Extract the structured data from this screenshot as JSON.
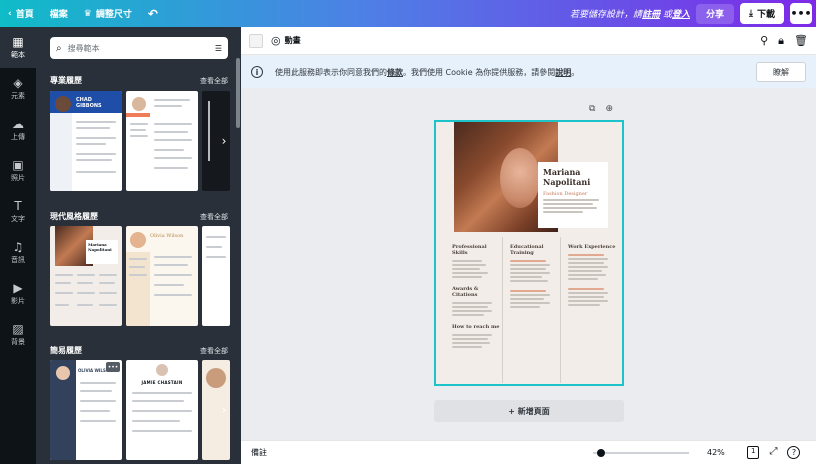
{
  "topbar": {
    "home": "首頁",
    "file": "檔案",
    "resize": "調整尺寸",
    "save_prompt": "若要儲存設計，請",
    "register": "註冊",
    "or": "或",
    "login": "登入",
    "share": "分享",
    "download": "下載"
  },
  "rail": [
    {
      "label": "範本",
      "icon": "template-icon"
    },
    {
      "label": "元素",
      "icon": "elements-icon"
    },
    {
      "label": "上傳",
      "icon": "upload-icon"
    },
    {
      "label": "照片",
      "icon": "photo-icon"
    },
    {
      "label": "文字",
      "icon": "text-icon"
    },
    {
      "label": "音訊",
      "icon": "audio-icon"
    },
    {
      "label": "影片",
      "icon": "video-icon"
    },
    {
      "label": "背景",
      "icon": "background-icon"
    }
  ],
  "panel": {
    "search_placeholder": "搜尋範本",
    "view_all": "查看全部",
    "sections": [
      "專業履歷",
      "現代風格履歷",
      "簡易履歷"
    ],
    "thumb_texts": {
      "chad": "CHAD GIBBONS",
      "mariana_1": "Mariana",
      "mariana_2": "Napolitani",
      "olivia": "Olivia Wilson",
      "olivia_caps": "OLIVIA WILSON",
      "jamie": "JAMIE CHASTAIN"
    }
  },
  "toolbar": {
    "animate": "動畫"
  },
  "cookie": {
    "text_a": "使用此服務即表示你同意我們的",
    "terms": "條款",
    "text_b": "。我們使用 Cookie 為你提供服務，請參閱",
    "policy": "說明",
    "text_c": "。",
    "ok": "瞭解"
  },
  "page": {
    "name_1": "Mariana",
    "name_2": "Napolitani",
    "role": "Fashion Designer",
    "col1_title": "Professional Skills",
    "col1_title2": "Awards & Citations",
    "col1_title3": "How to reach me",
    "col2_title": "Educational Training",
    "col3_title": "Work Experience"
  },
  "add_page": "+ 新增頁面",
  "bottom": {
    "notes": "備註",
    "zoom": "42%",
    "page_count": "1",
    "zoom_fraction": 0.04
  }
}
